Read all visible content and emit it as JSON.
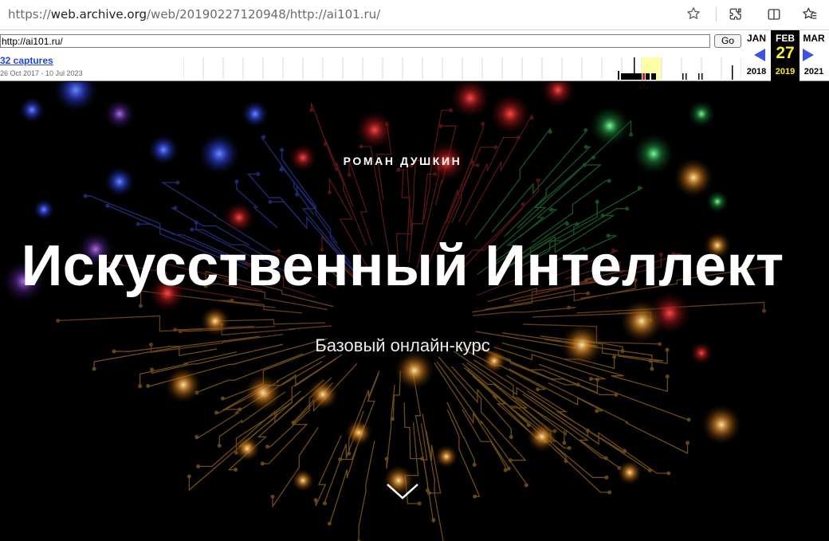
{
  "browser": {
    "url_scheme": "https://",
    "url_host": "web.archive.org",
    "url_path": "/web/20190227120948/http://ai101.ru/",
    "icons": [
      "star-icon",
      "extensions-icon",
      "split-view-icon",
      "favorites-icon"
    ]
  },
  "wayback": {
    "url_value": "http://ai101.ru/",
    "go_label": "Go",
    "captures_label": "32 captures",
    "range_label": "26 Oct 2017 - 10 Jul 2023",
    "prev": {
      "month": "JAN",
      "year": "2018"
    },
    "current": {
      "month": "FEB",
      "day": "27",
      "year": "2019"
    },
    "next": {
      "month": "MAR",
      "year": "2021"
    },
    "colors": {
      "current_bg": "#000000",
      "current_text": "#ffef20",
      "arrow": "#3a55e0",
      "highlight": "#ffffa8"
    }
  },
  "hero": {
    "author": "РОМАН ДУШКИН",
    "title": "Искусственный Интеллект",
    "subtitle": "Базовый онлайн-курс",
    "icons": [
      "chevron-down-icon"
    ]
  }
}
